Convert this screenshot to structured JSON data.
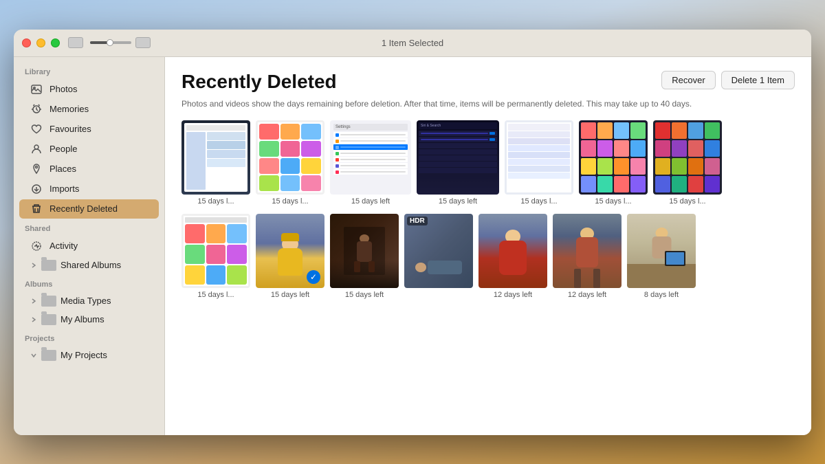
{
  "window": {
    "title": "1 Item Selected"
  },
  "titlebar": {
    "traffic_lights": [
      "close",
      "minimize",
      "maximize"
    ]
  },
  "sidebar": {
    "library_label": "Library",
    "shared_label": "Shared",
    "albums_label": "Albums",
    "projects_label": "Projects",
    "items": [
      {
        "id": "photos",
        "label": "Photos",
        "icon": "photo-icon"
      },
      {
        "id": "memories",
        "label": "Memories",
        "icon": "memories-icon"
      },
      {
        "id": "favourites",
        "label": "Favourites",
        "icon": "heart-icon"
      },
      {
        "id": "people",
        "label": "People",
        "icon": "person-icon"
      },
      {
        "id": "places",
        "label": "Places",
        "icon": "places-icon"
      },
      {
        "id": "imports",
        "label": "Imports",
        "icon": "imports-icon"
      },
      {
        "id": "recently-deleted",
        "label": "Recently Deleted",
        "icon": "trash-icon",
        "active": true
      }
    ],
    "shared_items": [
      {
        "id": "activity",
        "label": "Activity",
        "icon": "activity-icon"
      },
      {
        "id": "shared-albums",
        "label": "Shared Albums",
        "icon": "folder-icon",
        "expandable": true
      }
    ],
    "album_items": [
      {
        "id": "media-types",
        "label": "Media Types",
        "icon": "folder-icon",
        "expandable": true
      },
      {
        "id": "my-albums",
        "label": "My Albums",
        "icon": "folder-icon",
        "expandable": true
      }
    ],
    "project_items": [
      {
        "id": "my-projects",
        "label": "My Projects",
        "icon": "folder-icon",
        "expanded": true
      }
    ]
  },
  "main": {
    "title": "Recently Deleted",
    "subtitle": "Photos and videos show the days remaining before deletion. After that time, items will be permanently deleted. This may take up to 40 days.",
    "recover_label": "Recover",
    "delete_label": "Delete 1 Item",
    "photos": [
      {
        "row": 1,
        "items": [
          {
            "id": "p1",
            "caption": "15 days l...",
            "type": "library-screenshot"
          },
          {
            "id": "p2",
            "caption": "15 days l...",
            "type": "colorful-grid"
          },
          {
            "id": "p3",
            "caption": "15 days left",
            "type": "settings-screenshot"
          },
          {
            "id": "p4",
            "caption": "15 days left",
            "type": "siri-screenshot"
          },
          {
            "id": "p5",
            "caption": "15 days l...",
            "type": "phone-screenshot"
          },
          {
            "id": "p6",
            "caption": "15 days l...",
            "type": "colorful-grid-2"
          },
          {
            "id": "p7",
            "caption": "15 days l...",
            "type": "multicolor"
          }
        ]
      },
      {
        "row": 2,
        "items": [
          {
            "id": "p8",
            "caption": "15 days l...",
            "type": "app-grid-2"
          },
          {
            "id": "p9",
            "caption": "15 days left",
            "type": "baby-yellow",
            "selected": true
          },
          {
            "id": "p10",
            "caption": "15 days left",
            "type": "room-dark"
          },
          {
            "id": "p11",
            "caption": "",
            "type": "baby-lying",
            "hdr": true
          },
          {
            "id": "p12",
            "caption": "12 days left",
            "type": "baby-red"
          },
          {
            "id": "p13",
            "caption": "12 days left",
            "type": "baby-standing"
          },
          {
            "id": "p14",
            "caption": "8 days left",
            "type": "baby-table"
          }
        ]
      }
    ]
  }
}
